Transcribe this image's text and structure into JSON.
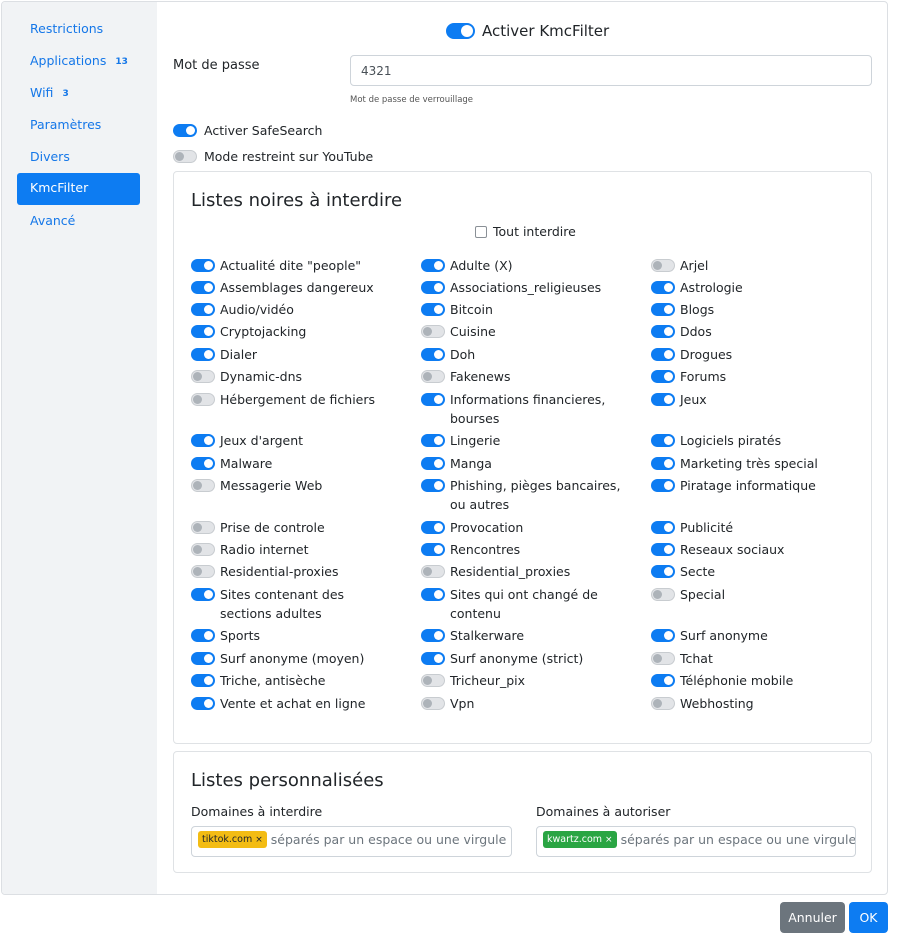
{
  "sidebar": {
    "items": [
      {
        "label": "Restrictions",
        "badge": null,
        "active": false
      },
      {
        "label": "Applications",
        "badge": "13",
        "active": false
      },
      {
        "label": "Wifi",
        "badge": "3",
        "active": false
      },
      {
        "label": "Paramètres",
        "badge": null,
        "active": false
      },
      {
        "label": "Divers",
        "badge": null,
        "active": false
      },
      {
        "label": "KmcFilter",
        "badge": null,
        "active": true
      },
      {
        "label": "Avancé",
        "badge": null,
        "active": false
      }
    ]
  },
  "main": {
    "enable_label": "Activer KmcFilter",
    "enable_on": true,
    "password_label": "Mot de passe",
    "password_value": "4321",
    "password_help": "Mot de passe de verrouillage",
    "safesearch_label": "Activer SafeSearch",
    "safesearch_on": true,
    "youtube_label": "Mode restreint sur YouTube",
    "youtube_on": false
  },
  "blacklists": {
    "title": "Listes noires à interdire",
    "all_label": "Tout interdire",
    "all_checked": false,
    "items": [
      {
        "label": "Actualité dite \"people\"",
        "on": true
      },
      {
        "label": "Adulte (X)",
        "on": true
      },
      {
        "label": "Arjel",
        "on": false
      },
      {
        "label": "Assemblages dangereux",
        "on": true
      },
      {
        "label": "Associations_religieuses",
        "on": true
      },
      {
        "label": "Astrologie",
        "on": true
      },
      {
        "label": "Audio/vidéo",
        "on": true
      },
      {
        "label": "Bitcoin",
        "on": true
      },
      {
        "label": "Blogs",
        "on": true
      },
      {
        "label": "Cryptojacking",
        "on": true
      },
      {
        "label": "Cuisine",
        "on": false
      },
      {
        "label": "Ddos",
        "on": true
      },
      {
        "label": "Dialer",
        "on": true
      },
      {
        "label": "Doh",
        "on": true
      },
      {
        "label": "Drogues",
        "on": true
      },
      {
        "label": "Dynamic-dns",
        "on": false
      },
      {
        "label": "Fakenews",
        "on": false
      },
      {
        "label": "Forums",
        "on": true
      },
      {
        "label": "Hébergement de fichiers",
        "on": false
      },
      {
        "label": "Informations financieres, bourses",
        "on": true
      },
      {
        "label": "Jeux",
        "on": true
      },
      {
        "label": "Jeux d'argent",
        "on": true
      },
      {
        "label": "Lingerie",
        "on": true
      },
      {
        "label": "Logiciels piratés",
        "on": true
      },
      {
        "label": "Malware",
        "on": true
      },
      {
        "label": "Manga",
        "on": true
      },
      {
        "label": "Marketing très special",
        "on": true
      },
      {
        "label": "Messagerie Web",
        "on": false
      },
      {
        "label": "Phishing, pièges bancaires, ou autres",
        "on": true
      },
      {
        "label": "Piratage informatique",
        "on": true
      },
      {
        "label": "Prise de controle",
        "on": false
      },
      {
        "label": "Provocation",
        "on": true
      },
      {
        "label": "Publicité",
        "on": true
      },
      {
        "label": "Radio internet",
        "on": false
      },
      {
        "label": "Rencontres",
        "on": true
      },
      {
        "label": "Reseaux sociaux",
        "on": true
      },
      {
        "label": "Residential-proxies",
        "on": false
      },
      {
        "label": "Residential_proxies",
        "on": false
      },
      {
        "label": "Secte",
        "on": true
      },
      {
        "label": "Sites contenant des sections adultes",
        "on": true
      },
      {
        "label": "Sites qui ont changé de contenu",
        "on": true
      },
      {
        "label": "Special",
        "on": false
      },
      {
        "label": "Sports",
        "on": true
      },
      {
        "label": "Stalkerware",
        "on": true
      },
      {
        "label": "Surf anonyme",
        "on": true
      },
      {
        "label": "Surf anonyme (moyen)",
        "on": true
      },
      {
        "label": "Surf anonyme (strict)",
        "on": true
      },
      {
        "label": "Tchat",
        "on": false
      },
      {
        "label": "Triche, antisèche",
        "on": true
      },
      {
        "label": "Tricheur_pix",
        "on": false
      },
      {
        "label": "Téléphonie mobile",
        "on": true
      },
      {
        "label": "Vente et achat en ligne",
        "on": true
      },
      {
        "label": "Vpn",
        "on": false
      },
      {
        "label": "Webhosting",
        "on": false
      }
    ]
  },
  "custom_lists": {
    "title": "Listes personnalisées",
    "deny_label": "Domaines à interdire",
    "deny_tags": [
      "tiktok.com"
    ],
    "deny_placeholder": "séparés par un espace ou une virgule",
    "allow_label": "Domaines à autoriser",
    "allow_tags": [
      "kwartz.com"
    ],
    "allow_placeholder": "séparés par un espace ou une virgule",
    "tag_remove_glyph": "×"
  },
  "footer": {
    "cancel_label": "Annuler",
    "ok_label": "OK"
  },
  "colors": {
    "accent": "#0d7cf2",
    "deny_tag": "#f3bc13",
    "allow_tag": "#2aa543",
    "cancel_button": "#6c757d"
  }
}
